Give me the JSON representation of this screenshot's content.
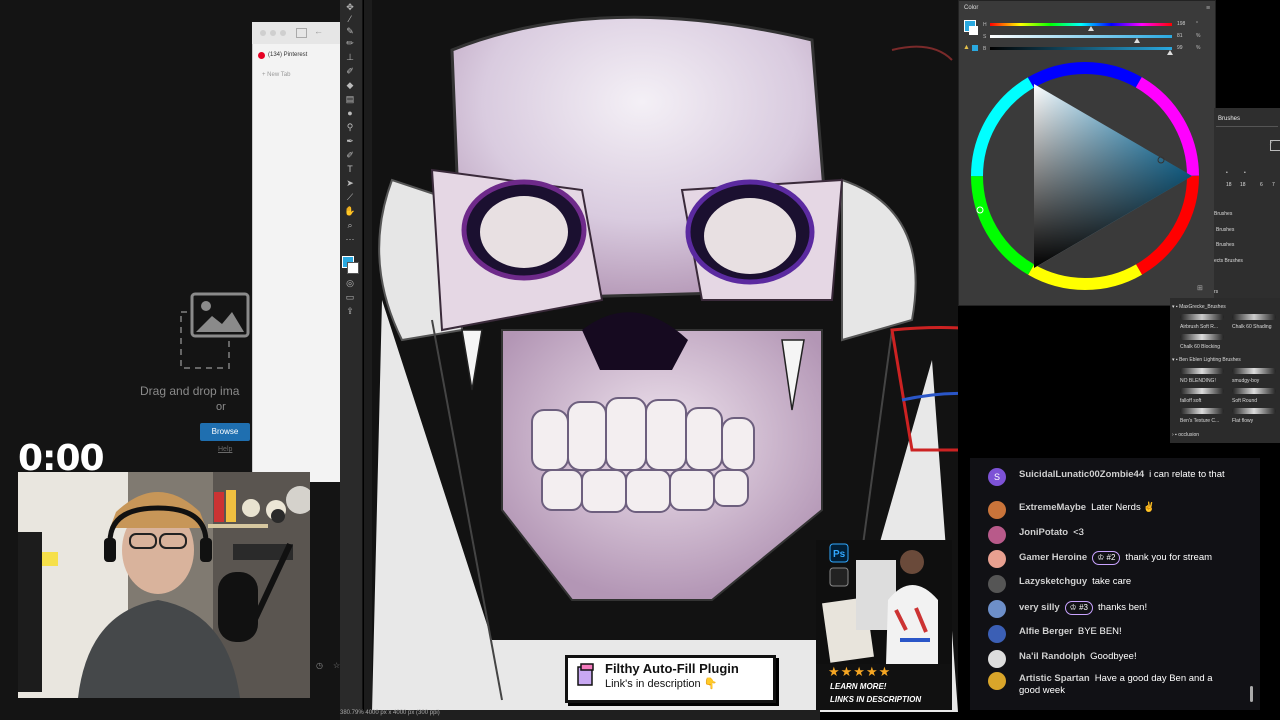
{
  "browser": {
    "tabs": [
      "(134) Pinterest",
      "New Tab"
    ]
  },
  "upload": {
    "drop_text": "Drag and drop ima",
    "or_text": "or",
    "browse_label": "Browse",
    "help_label": "Help"
  },
  "stream": {
    "timer": "0:00"
  },
  "photoshop": {
    "status": "380.79%   4000 px x 4000 px (300 ppi)",
    "color_panel": {
      "title": "Color",
      "sliders": [
        {
          "label": "H",
          "value": "198",
          "fraction": 0.55
        },
        {
          "label": "S",
          "value": "81",
          "fraction": 0.81
        },
        {
          "label": "B",
          "value": "99",
          "fraction": 0.99
        }
      ]
    },
    "brushes": {
      "tab_label": "Brushes",
      "numbers": [
        "18",
        "18",
        "6",
        "7"
      ],
      "partial_items": [
        "Brushes",
        "Brushes",
        "Brushes",
        "ects Brushes",
        "rs"
      ],
      "groups": [
        {
          "name": "MaxGrecke_Brushes",
          "items": [
            "Airbrush Soft R...",
            "Chalk 60 Shading",
            "Chalk 60 Blocking"
          ]
        },
        {
          "name": "Ben Eblen Lighting Brushes",
          "items": [
            "NO BLENDING!",
            "smudgy-boy",
            "falloff soft",
            "Soft Round",
            "Ben's Texture C...",
            "Flat flowy"
          ]
        },
        {
          "name": "occlusion",
          "items": []
        }
      ]
    }
  },
  "chat": [
    {
      "name": "SuicidalLunatic00Zombie44",
      "badge": "",
      "message": "i can relate to that",
      "avatar_color": "#7d52d6",
      "initial": "S"
    },
    {
      "name": "ExtremeMaybe",
      "badge": "",
      "message": "Later Nerds ✌",
      "avatar_color": "#c9743a",
      "initial": ""
    },
    {
      "name": "JoniPotato",
      "badge": "",
      "message": "<3",
      "avatar_color": "#b85a8a",
      "initial": ""
    },
    {
      "name": "Gamer Heroine",
      "badge": "#2",
      "message": "thank you for stream",
      "avatar_color": "#e8a090",
      "initial": ""
    },
    {
      "name": "Lazysketchguy",
      "badge": "",
      "message": "take care",
      "avatar_color": "#555",
      "initial": ""
    },
    {
      "name": "very silly",
      "badge": "#3",
      "message": "thanks ben!",
      "avatar_color": "#6d8fc9",
      "initial": ""
    },
    {
      "name": "Alfie Berger",
      "badge": "",
      "message": "BYE BEN!",
      "avatar_color": "#3b5fb5",
      "initial": ""
    },
    {
      "name": "Na'il Randolph",
      "badge": "",
      "message": "Goodbyee!",
      "avatar_color": "#ddd",
      "initial": ""
    },
    {
      "name": "Artistic Spartan",
      "badge": "",
      "message": "Have a good day Ben and a good week",
      "avatar_color": "#d9a52a",
      "initial": ""
    }
  ],
  "plugin": {
    "title": "Filthy Auto-Fill Plugin",
    "subtitle": "Link's in description 👇"
  },
  "promo": {
    "stars": "★★★★★",
    "learn_more": "LEARN MORE!",
    "links": "LINKS IN DESCRIPTION"
  },
  "colors": {
    "accent_blue": "#1f6fb0",
    "badge_purple": "#c9a3ff",
    "skull_light": "#e9e4ef"
  }
}
